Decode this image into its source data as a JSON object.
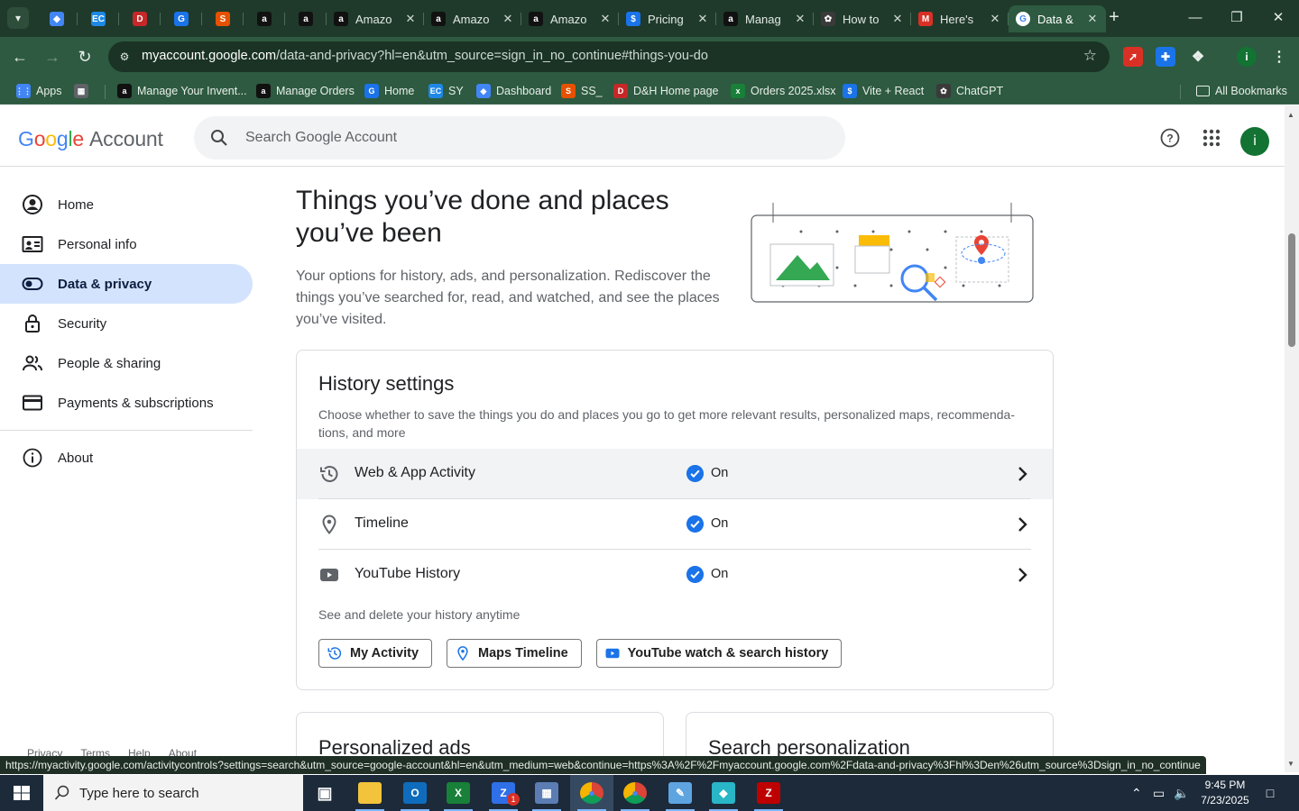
{
  "browser": {
    "tabs": [
      {
        "title": "",
        "icon": "chrome-web-store-icon",
        "color": "#4285f4",
        "pinned": true
      },
      {
        "title": "",
        "icon": "ec-icon",
        "color": "#1e88e5",
        "pinned": true
      },
      {
        "title": "",
        "icon": "dh-icon",
        "color": "#c62828",
        "pinned": true
      },
      {
        "title": "",
        "icon": "google-docs-icon",
        "color": "#1a73e8",
        "pinned": true
      },
      {
        "title": "",
        "icon": "ss-icon",
        "color": "#e65100",
        "pinned": true
      },
      {
        "title": "",
        "icon": "amazon-icon",
        "color": "#111",
        "pinned": true
      },
      {
        "title": "",
        "icon": "amazon-icon",
        "color": "#111",
        "pinned": true
      },
      {
        "title": "Amazo",
        "icon": "amazon-icon",
        "color": "#111",
        "pinned": false
      },
      {
        "title": "Amazo",
        "icon": "amazon-icon",
        "color": "#111",
        "pinned": false
      },
      {
        "title": "Amazo",
        "icon": "amazon-icon",
        "color": "#111",
        "pinned": false
      },
      {
        "title": "Pricing",
        "icon": "dollar-icon",
        "color": "#1a73e8",
        "pinned": false
      },
      {
        "title": "Manag",
        "icon": "amazon-icon",
        "color": "#111",
        "pinned": false
      },
      {
        "title": "How to",
        "icon": "chatgpt-icon",
        "color": "#3a3a3a",
        "pinned": false
      },
      {
        "title": "Here's",
        "icon": "gmail-icon",
        "color": "#d93025",
        "pinned": false
      },
      {
        "title": "Data &",
        "icon": "google-icon",
        "color": "#ffffff",
        "pinned": false,
        "active": true
      }
    ],
    "url_host": "myaccount.google.com",
    "url_path": "/data-and-privacy?hl=en&utm_source=sign_in_no_continue#things-you-do",
    "bookmarks": [
      {
        "label": "Apps",
        "icon": "apps-grid-icon",
        "color": "#4285f4"
      },
      {
        "label": "",
        "icon": "tab-groups-icon",
        "color": "#5f6368"
      },
      {
        "label": "Manage Your Invent...",
        "icon": "amazon-icon",
        "color": "#111"
      },
      {
        "label": "Manage Orders",
        "icon": "amazon-icon",
        "color": "#111"
      },
      {
        "label": "Home",
        "icon": "google-docs-icon",
        "color": "#1a73e8"
      },
      {
        "label": "SY",
        "icon": "ec-icon",
        "color": "#1e88e5"
      },
      {
        "label": "Dashboard",
        "icon": "chrome-web-store-icon",
        "color": "#4285f4"
      },
      {
        "label": "SS_",
        "icon": "ss-icon",
        "color": "#e65100"
      },
      {
        "label": "D&H Home page",
        "icon": "dh-icon",
        "color": "#c62828"
      },
      {
        "label": "Orders 2025.xlsx",
        "icon": "excel-icon",
        "color": "#188038"
      },
      {
        "label": "Vite + React",
        "icon": "dollar-icon",
        "color": "#1a73e8"
      },
      {
        "label": "ChatGPT",
        "icon": "chatgpt-icon",
        "color": "#3a3a3a"
      }
    ],
    "all_bookmarks": "All Bookmarks",
    "status_url": "https://myactivity.google.com/activitycontrols?settings=search&utm_source=google-account&hl=en&utm_medium=web&continue=https%3A%2F%2Fmyaccount.google.com%2Fdata-and-privacy%3Fhl%3Den%26utm_source%3Dsign_in_no_continue"
  },
  "account": {
    "logo": {
      "g1": "G",
      "o1": "o",
      "o2": "o",
      "g2": "g",
      "l": "l",
      "e": "e",
      "account": "Account"
    },
    "search_placeholder": "Search Google Account",
    "avatar_initial": "i",
    "nav": [
      {
        "label": "Home",
        "icon": "person-circle-icon"
      },
      {
        "label": "Personal info",
        "icon": "id-card-icon"
      },
      {
        "label": "Data & privacy",
        "icon": "toggle-icon",
        "active": true
      },
      {
        "label": "Security",
        "icon": "lock-icon"
      },
      {
        "label": "People & sharing",
        "icon": "people-icon"
      },
      {
        "label": "Payments & subscriptions",
        "icon": "credit-card-icon"
      },
      {
        "label": "About",
        "icon": "info-icon"
      }
    ],
    "footer": [
      "Privacy",
      "Terms",
      "Help",
      "About"
    ],
    "hero_title": "Things you’ve done and places you’ve been",
    "hero_desc": "Your options for history, ads, and personalization. Rediscover the things you’ve searched for, read, and watched, and see the places you’ve visited.",
    "history": {
      "title": "History settings",
      "desc": "Choose whether to save the things you do and places you go to get more relevant results, personalized maps, recommenda-tions, and more",
      "rows": [
        {
          "name": "Web & App Activity",
          "status": "On",
          "icon": "history-clock-icon"
        },
        {
          "name": "Timeline",
          "status": "On",
          "icon": "location-pin-icon"
        },
        {
          "name": "YouTube History",
          "status": "On",
          "icon": "youtube-icon"
        }
      ],
      "see_all": "See and delete your history anytime",
      "buttons": [
        {
          "label": "My Activity",
          "icon": "history-clock-icon"
        },
        {
          "label": "Maps Timeline",
          "icon": "location-pin-icon"
        },
        {
          "label": "YouTube watch & search history",
          "icon": "youtube-icon"
        }
      ]
    },
    "cards": [
      "Personalized ads",
      "Search personalization"
    ]
  },
  "taskbar": {
    "search_placeholder": "Type here to search",
    "time": "9:45 PM",
    "date": "7/23/2025",
    "apps": [
      {
        "icon": "task-view-icon",
        "color": "#ffffff"
      },
      {
        "icon": "file-explorer-icon",
        "color": "#f3c33b"
      },
      {
        "icon": "outlook-icon",
        "color": "#0f6cbd"
      },
      {
        "icon": "excel-icon",
        "color": "#188038"
      },
      {
        "icon": "zoho-icon",
        "color": "#2f6fe8"
      },
      {
        "icon": "calculator-icon",
        "color": "#5b7db3"
      },
      {
        "icon": "chrome-icon",
        "color": "#db4437"
      },
      {
        "icon": "chrome-icon",
        "color": "#db4437"
      },
      {
        "icon": "notes-icon",
        "color": "#5ea4e0"
      },
      {
        "icon": "app-icon",
        "color": "#29b6c6"
      },
      {
        "icon": "filezilla-icon",
        "color": "#bf0000"
      }
    ],
    "zoho_badge": "1"
  }
}
